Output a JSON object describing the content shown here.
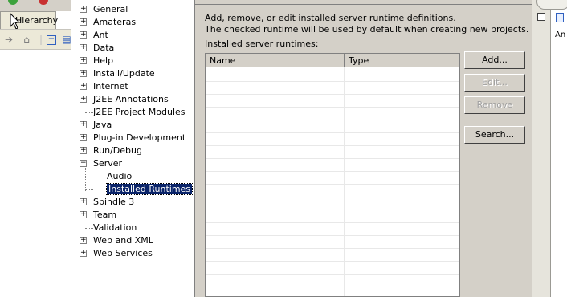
{
  "hierarchy": {
    "tab_label": "Hierarchy"
  },
  "tree": {
    "items": [
      {
        "label": "General",
        "expander": "+"
      },
      {
        "label": "Amateras",
        "expander": "+"
      },
      {
        "label": "Ant",
        "expander": "+"
      },
      {
        "label": "Data",
        "expander": "+"
      },
      {
        "label": "Help",
        "expander": "+"
      },
      {
        "label": "Install/Update",
        "expander": "+"
      },
      {
        "label": "Internet",
        "expander": "+"
      },
      {
        "label": "J2EE Annotations",
        "expander": "+"
      },
      {
        "label": "J2EE Project Modules",
        "expander": ""
      },
      {
        "label": "Java",
        "expander": "+"
      },
      {
        "label": "Plug-in Development",
        "expander": "+"
      },
      {
        "label": "Run/Debug",
        "expander": "+"
      },
      {
        "label": "Server",
        "expander": "−"
      },
      {
        "label": "Audio",
        "expander": "",
        "child": true
      },
      {
        "label": "Installed Runtimes",
        "expander": "",
        "child": true,
        "selected": true
      },
      {
        "label": "Spindle 3",
        "expander": "+"
      },
      {
        "label": "Team",
        "expander": "+"
      },
      {
        "label": "Validation",
        "expander": ""
      },
      {
        "label": "Web and XML",
        "expander": "+"
      },
      {
        "label": "Web Services",
        "expander": "+"
      }
    ]
  },
  "page": {
    "description_line1": "Add, remove, or edit installed server runtime definitions.",
    "description_line2": "The checked runtime will be used by default when creating new projects.",
    "table_label": "Installed server runtimes:",
    "columns": [
      "Name",
      "Type"
    ]
  },
  "buttons": {
    "add": "Add...",
    "edit": "Edit...",
    "remove": "Remove",
    "search": "Search..."
  },
  "right_panel": {
    "label": "An"
  }
}
